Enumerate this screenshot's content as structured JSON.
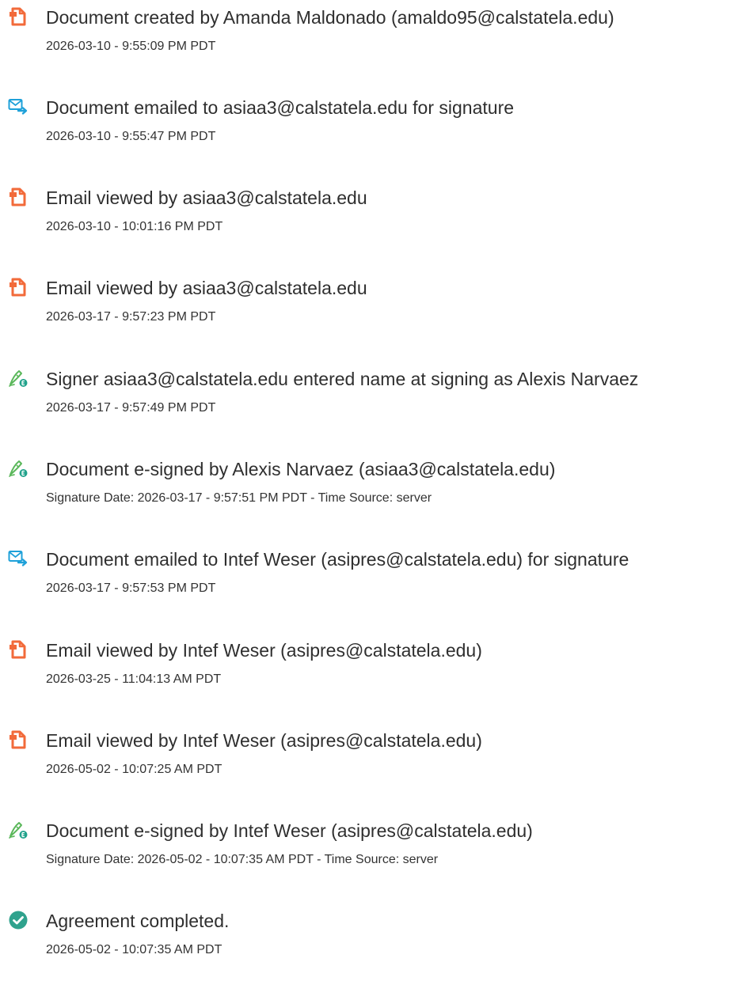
{
  "colors": {
    "doc_icon": "#f26a3a",
    "email_icon": "#1fa1d9",
    "sign_icon_accent": "#21a28b",
    "complete_icon": "#2fa28d"
  },
  "events": [
    {
      "icon": "document-icon",
      "title": "Document created by Amanda Maldonado (amaldo95@calstatela.edu)",
      "meta": "2026-03-10 - 9:55:09 PM PDT"
    },
    {
      "icon": "email-sent-icon",
      "title": "Document emailed to asiaa3@calstatela.edu for signature",
      "meta": "2026-03-10 - 9:55:47 PM PDT"
    },
    {
      "icon": "document-icon",
      "title": "Email viewed by asiaa3@calstatela.edu",
      "meta": "2026-03-10 - 10:01:16 PM PDT"
    },
    {
      "icon": "document-icon",
      "title": "Email viewed by asiaa3@calstatela.edu",
      "meta": "2026-03-17 - 9:57:23 PM PDT"
    },
    {
      "icon": "esign-pen-icon",
      "title": "Signer asiaa3@calstatela.edu entered name at signing as Alexis Narvaez",
      "meta": "2026-03-17 - 9:57:49 PM PDT"
    },
    {
      "icon": "esign-pen-icon",
      "title": "Document e-signed by Alexis Narvaez (asiaa3@calstatela.edu)",
      "meta": "Signature Date: 2026-03-17 - 9:57:51 PM PDT - Time Source: server"
    },
    {
      "icon": "email-sent-icon",
      "title": "Document emailed to Intef Weser (asipres@calstatela.edu) for signature",
      "meta": "2026-03-17 - 9:57:53 PM PDT"
    },
    {
      "icon": "document-icon",
      "title": "Email viewed by Intef Weser (asipres@calstatela.edu)",
      "meta": "2026-03-25 - 11:04:13 AM PDT"
    },
    {
      "icon": "document-icon",
      "title": "Email viewed by Intef Weser (asipres@calstatela.edu)",
      "meta": "2026-05-02 - 10:07:25 AM PDT"
    },
    {
      "icon": "esign-pen-icon",
      "title": "Document e-signed by Intef Weser (asipres@calstatela.edu)",
      "meta": "Signature Date: 2026-05-02 - 10:07:35 AM PDT - Time Source: server"
    },
    {
      "icon": "check-circle-icon",
      "title": "Agreement completed.",
      "meta": "2026-05-02 - 10:07:35 AM PDT"
    }
  ]
}
